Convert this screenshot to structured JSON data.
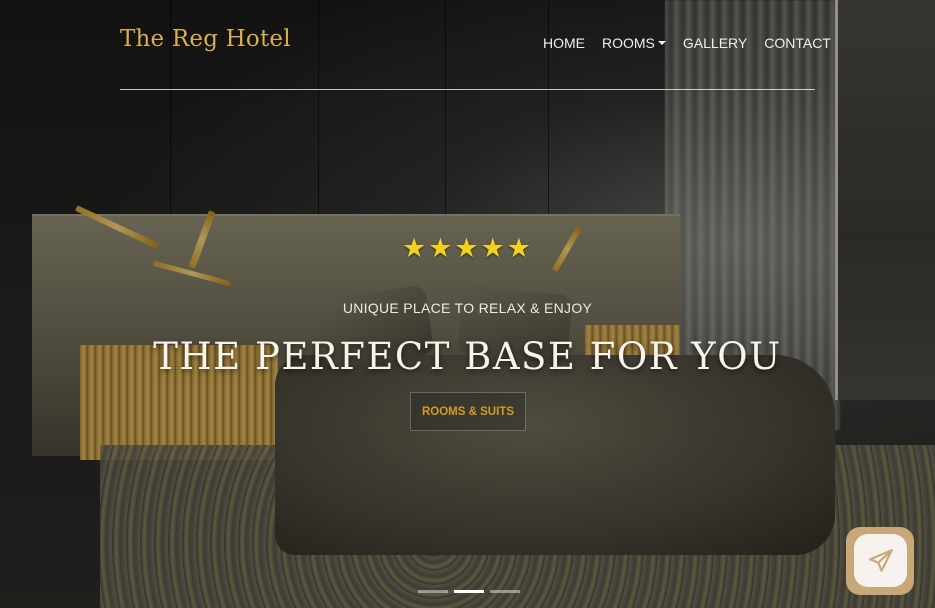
{
  "header": {
    "brand": "The Reg Hotel",
    "nav": [
      {
        "label": "HOME"
      },
      {
        "label": "ROOMS",
        "has_dropdown": true
      },
      {
        "label": "GALLERY"
      },
      {
        "label": "CONTACT"
      }
    ]
  },
  "hero": {
    "rating_stars": "★★★★★",
    "rating": 5,
    "subtitle": "UNIQUE PLACE TO RELAX & ENJOY",
    "headline": "THE PERFECT BASE FOR YOU",
    "cta_label": "ROOMS & SUITS"
  },
  "carousel": {
    "slide_count": 3,
    "active_index": 1
  },
  "contact_fab": {
    "icon": "paper-plane-icon"
  },
  "colors": {
    "brand_gold": "#d7ae50",
    "cta_text": "#d49a2a",
    "star": "#f2d21f",
    "fab_border": "#c8a878"
  }
}
